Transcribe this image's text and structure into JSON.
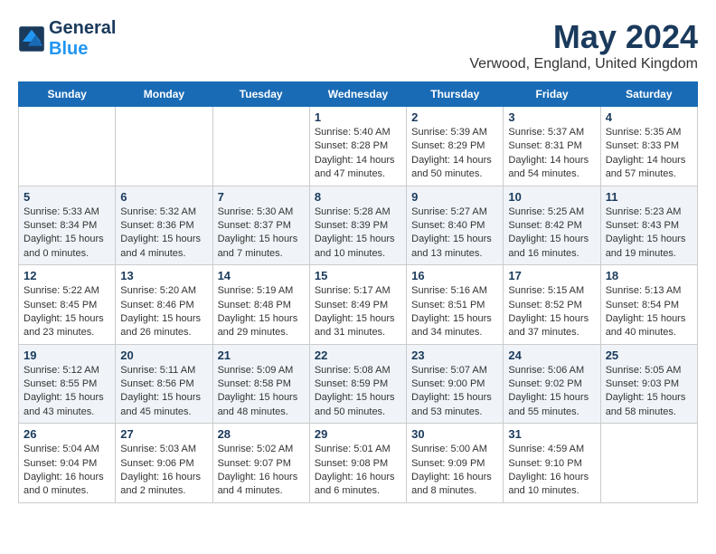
{
  "header": {
    "logo_general": "General",
    "logo_blue": "Blue",
    "month_title": "May 2024",
    "subtitle": "Verwood, England, United Kingdom"
  },
  "days_of_week": [
    "Sunday",
    "Monday",
    "Tuesday",
    "Wednesday",
    "Thursday",
    "Friday",
    "Saturday"
  ],
  "weeks": [
    [
      {
        "day": "",
        "info": ""
      },
      {
        "day": "",
        "info": ""
      },
      {
        "day": "",
        "info": ""
      },
      {
        "day": "1",
        "info": "Sunrise: 5:40 AM\nSunset: 8:28 PM\nDaylight: 14 hours\nand 47 minutes."
      },
      {
        "day": "2",
        "info": "Sunrise: 5:39 AM\nSunset: 8:29 PM\nDaylight: 14 hours\nand 50 minutes."
      },
      {
        "day": "3",
        "info": "Sunrise: 5:37 AM\nSunset: 8:31 PM\nDaylight: 14 hours\nand 54 minutes."
      },
      {
        "day": "4",
        "info": "Sunrise: 5:35 AM\nSunset: 8:33 PM\nDaylight: 14 hours\nand 57 minutes."
      }
    ],
    [
      {
        "day": "5",
        "info": "Sunrise: 5:33 AM\nSunset: 8:34 PM\nDaylight: 15 hours\nand 0 minutes."
      },
      {
        "day": "6",
        "info": "Sunrise: 5:32 AM\nSunset: 8:36 PM\nDaylight: 15 hours\nand 4 minutes."
      },
      {
        "day": "7",
        "info": "Sunrise: 5:30 AM\nSunset: 8:37 PM\nDaylight: 15 hours\nand 7 minutes."
      },
      {
        "day": "8",
        "info": "Sunrise: 5:28 AM\nSunset: 8:39 PM\nDaylight: 15 hours\nand 10 minutes."
      },
      {
        "day": "9",
        "info": "Sunrise: 5:27 AM\nSunset: 8:40 PM\nDaylight: 15 hours\nand 13 minutes."
      },
      {
        "day": "10",
        "info": "Sunrise: 5:25 AM\nSunset: 8:42 PM\nDaylight: 15 hours\nand 16 minutes."
      },
      {
        "day": "11",
        "info": "Sunrise: 5:23 AM\nSunset: 8:43 PM\nDaylight: 15 hours\nand 19 minutes."
      }
    ],
    [
      {
        "day": "12",
        "info": "Sunrise: 5:22 AM\nSunset: 8:45 PM\nDaylight: 15 hours\nand 23 minutes."
      },
      {
        "day": "13",
        "info": "Sunrise: 5:20 AM\nSunset: 8:46 PM\nDaylight: 15 hours\nand 26 minutes."
      },
      {
        "day": "14",
        "info": "Sunrise: 5:19 AM\nSunset: 8:48 PM\nDaylight: 15 hours\nand 29 minutes."
      },
      {
        "day": "15",
        "info": "Sunrise: 5:17 AM\nSunset: 8:49 PM\nDaylight: 15 hours\nand 31 minutes."
      },
      {
        "day": "16",
        "info": "Sunrise: 5:16 AM\nSunset: 8:51 PM\nDaylight: 15 hours\nand 34 minutes."
      },
      {
        "day": "17",
        "info": "Sunrise: 5:15 AM\nSunset: 8:52 PM\nDaylight: 15 hours\nand 37 minutes."
      },
      {
        "day": "18",
        "info": "Sunrise: 5:13 AM\nSunset: 8:54 PM\nDaylight: 15 hours\nand 40 minutes."
      }
    ],
    [
      {
        "day": "19",
        "info": "Sunrise: 5:12 AM\nSunset: 8:55 PM\nDaylight: 15 hours\nand 43 minutes."
      },
      {
        "day": "20",
        "info": "Sunrise: 5:11 AM\nSunset: 8:56 PM\nDaylight: 15 hours\nand 45 minutes."
      },
      {
        "day": "21",
        "info": "Sunrise: 5:09 AM\nSunset: 8:58 PM\nDaylight: 15 hours\nand 48 minutes."
      },
      {
        "day": "22",
        "info": "Sunrise: 5:08 AM\nSunset: 8:59 PM\nDaylight: 15 hours\nand 50 minutes."
      },
      {
        "day": "23",
        "info": "Sunrise: 5:07 AM\nSunset: 9:00 PM\nDaylight: 15 hours\nand 53 minutes."
      },
      {
        "day": "24",
        "info": "Sunrise: 5:06 AM\nSunset: 9:02 PM\nDaylight: 15 hours\nand 55 minutes."
      },
      {
        "day": "25",
        "info": "Sunrise: 5:05 AM\nSunset: 9:03 PM\nDaylight: 15 hours\nand 58 minutes."
      }
    ],
    [
      {
        "day": "26",
        "info": "Sunrise: 5:04 AM\nSunset: 9:04 PM\nDaylight: 16 hours\nand 0 minutes."
      },
      {
        "day": "27",
        "info": "Sunrise: 5:03 AM\nSunset: 9:06 PM\nDaylight: 16 hours\nand 2 minutes."
      },
      {
        "day": "28",
        "info": "Sunrise: 5:02 AM\nSunset: 9:07 PM\nDaylight: 16 hours\nand 4 minutes."
      },
      {
        "day": "29",
        "info": "Sunrise: 5:01 AM\nSunset: 9:08 PM\nDaylight: 16 hours\nand 6 minutes."
      },
      {
        "day": "30",
        "info": "Sunrise: 5:00 AM\nSunset: 9:09 PM\nDaylight: 16 hours\nand 8 minutes."
      },
      {
        "day": "31",
        "info": "Sunrise: 4:59 AM\nSunset: 9:10 PM\nDaylight: 16 hours\nand 10 minutes."
      },
      {
        "day": "",
        "info": ""
      }
    ]
  ]
}
